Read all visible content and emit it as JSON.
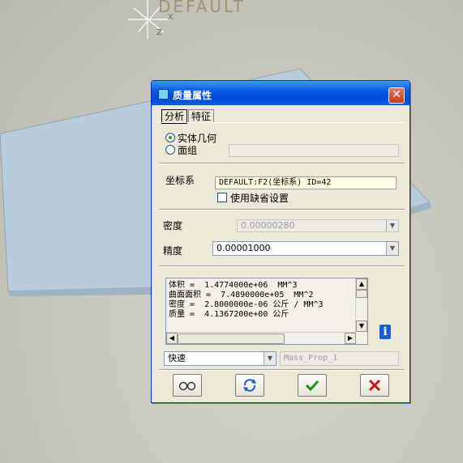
{
  "viewport": {
    "csys_label": "DEFAULT",
    "axis_x": "X",
    "axis_z": "Z"
  },
  "dialog": {
    "title": "质量属性",
    "close_glyph": "✕",
    "tabs": [
      {
        "label": "分析",
        "active": true
      },
      {
        "label": "特征",
        "active": false
      }
    ],
    "geometry_type": {
      "options": [
        {
          "label": "实体几何",
          "selected": true
        },
        {
          "label": "面组",
          "selected": false
        }
      ],
      "quilt_value": ""
    },
    "coord_system": {
      "label": "坐标系",
      "value": "DEFAULT:F2(坐标系) ID=42",
      "use_default_label": "使用缺省设置",
      "use_default_checked": false
    },
    "density": {
      "label": "密度",
      "value": "0.00000280"
    },
    "accuracy": {
      "label": "精度",
      "value": "0.00001000"
    },
    "results": [
      "体积 =  1.4774000e+06  MM^3",
      "曲面面积 =  7.4890000e+05  MM^2",
      "密度 =  2.8000000e-06 公斤 / MM^3",
      "质量 =  4.1367200e+00 公斤"
    ],
    "mode": {
      "value": "快速"
    },
    "param_name": {
      "value": "Mass_Prop_1"
    },
    "buttons": {
      "preview_icon": "glasses-icon",
      "repeat_icon": "refresh-icon",
      "ok_icon": "check-icon",
      "cancel_icon": "x-icon"
    },
    "colors": {
      "title_bar": "#0a5ce0",
      "ok_green": "#1f8f1f",
      "cancel_red": "#c81818"
    }
  }
}
